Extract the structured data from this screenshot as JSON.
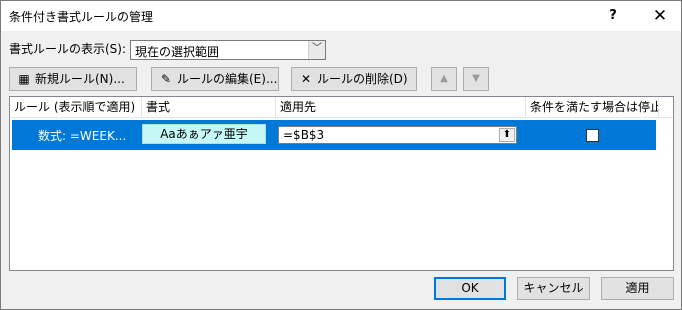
{
  "window": {
    "title": "条件付き書式ルールの管理",
    "help": "?",
    "close": "✕"
  },
  "show_rules": {
    "label": "書式ルールの表示(S):",
    "value": "現在の選択範囲"
  },
  "toolbar": {
    "new_rule": "新規ルール(N)...",
    "edit_rule": "ルールの編集(E)...",
    "delete_rule": "ルールの削除(D)",
    "move_up": "▲",
    "move_down": "▼"
  },
  "grid": {
    "columns": {
      "rule": "ルール (表示順で適用)",
      "format": "書式",
      "applies_to": "適用先",
      "stop_if_true": "条件を満たす場合は停止"
    },
    "rows": [
      {
        "rule": "数式: =WEEK...",
        "format_preview": "Aaあぁアァ亜宇",
        "applies_to": "=$B$3",
        "stop_if_true": false
      }
    ]
  },
  "footer": {
    "ok": "OK",
    "cancel": "キャンセル",
    "apply": "適用"
  },
  "colors": {
    "selection": "#0078d7",
    "format_preview_bg": "#c6f7f7"
  }
}
